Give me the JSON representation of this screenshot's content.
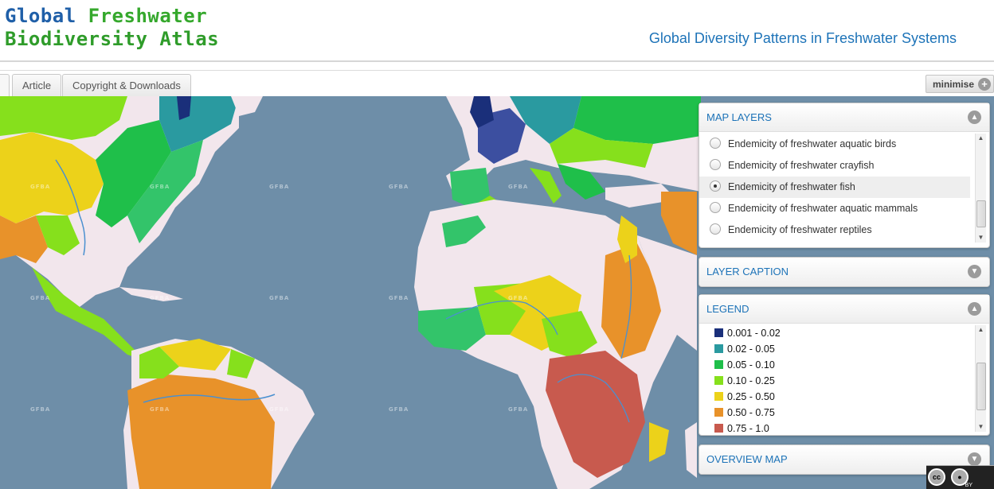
{
  "header": {
    "logo_line1_word1": "Global",
    "logo_line1_word2": "Freshwater",
    "logo_line2": "Biodiversity Atlas",
    "subtitle": "Global Diversity Patterns in Freshwater Systems"
  },
  "tabs": [
    {
      "label": "Article"
    },
    {
      "label": "Copyright & Downloads"
    }
  ],
  "minimise": {
    "label": "minimise",
    "icon": "plus-circle-icon"
  },
  "map": {
    "watermark": "GFBA",
    "colors": {
      "ocean": "#6e8ea8",
      "land_nodata": "#f2e6ec"
    }
  },
  "panels": {
    "map_layers": {
      "title": "MAP LAYERS",
      "toggle_icon": "chevron-up-icon",
      "layers": [
        {
          "label": "Endemicity of freshwater aquatic birds",
          "selected": false
        },
        {
          "label": "Endemicity of freshwater crayfish",
          "selected": false
        },
        {
          "label": "Endemicity of freshwater fish",
          "selected": true
        },
        {
          "label": "Endemicity of freshwater aquatic mammals",
          "selected": false
        },
        {
          "label": "Endemicity of freshwater reptiles",
          "selected": false
        }
      ]
    },
    "layer_caption": {
      "title": "LAYER CAPTION",
      "toggle_icon": "chevron-down-icon"
    },
    "legend": {
      "title": "LEGEND",
      "toggle_icon": "chevron-up-icon",
      "items": [
        {
          "label": "0.001 - 0.02",
          "color": "#1a2f7a"
        },
        {
          "label": "0.02 - 0.05",
          "color": "#2a9aa0"
        },
        {
          "label": "0.05 - 0.10",
          "color": "#1fbf4a"
        },
        {
          "label": "0.10 - 0.25",
          "color": "#86e01c"
        },
        {
          "label": "0.25 - 0.50",
          "color": "#ecd21a"
        },
        {
          "label": "0.50 - 0.75",
          "color": "#e8922a"
        },
        {
          "label": "0.75 - 1.0",
          "color": "#c85a4e"
        }
      ]
    },
    "overview_map": {
      "title": "OVERVIEW MAP",
      "toggle_icon": "chevron-down-icon"
    }
  },
  "license": {
    "cc": "cc",
    "by": "BY",
    "attribution_icon": "person-icon"
  }
}
